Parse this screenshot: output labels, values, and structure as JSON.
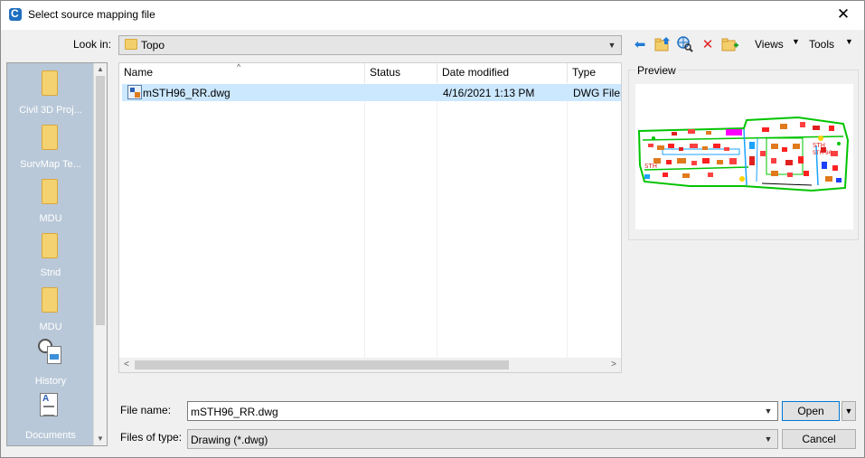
{
  "window": {
    "title": "Select source mapping file",
    "close_glyph": "✕"
  },
  "lookin": {
    "label": "Look in:",
    "value": "Topo"
  },
  "toolbar": {
    "back_icon": "back-arrow-icon",
    "up_icon": "up-folder-icon",
    "web_icon": "search-web-icon",
    "delete_icon": "delete-icon",
    "new_folder_icon": "new-folder-icon",
    "views_label": "Views",
    "tools_label": "Tools"
  },
  "places": [
    {
      "label": "Civil 3D Proj...",
      "icon": "folder-icon"
    },
    {
      "label": "SurvMap Te...",
      "icon": "folder-icon"
    },
    {
      "label": "MDU",
      "icon": "folder-icon"
    },
    {
      "label": "Stnd",
      "icon": "folder-icon"
    },
    {
      "label": "MDU",
      "icon": "folder-icon"
    },
    {
      "label": "History",
      "icon": "history-icon"
    },
    {
      "label": "Documents",
      "icon": "documents-icon"
    }
  ],
  "file_list": {
    "columns": [
      "Name",
      "Status",
      "Date modified",
      "Type"
    ],
    "rows": [
      {
        "name": "mSTH96_RR.dwg",
        "status": "",
        "date": "4/16/2021 1:13 PM",
        "type": "DWG File",
        "selected": true
      }
    ]
  },
  "preview": {
    "label": "Preview",
    "drawing_labels": [
      "STH",
      "STH",
      "STH 96"
    ]
  },
  "file_name": {
    "label": "File name:",
    "value": "mSTH96_RR.dwg"
  },
  "file_type": {
    "label": "Files of type:",
    "value": "Drawing (*.dwg)"
  },
  "buttons": {
    "open": "Open",
    "cancel": "Cancel"
  },
  "colors": {
    "selection": "#cce8ff",
    "places_bg": "#b9c8d8",
    "accent": "#0078d7"
  }
}
